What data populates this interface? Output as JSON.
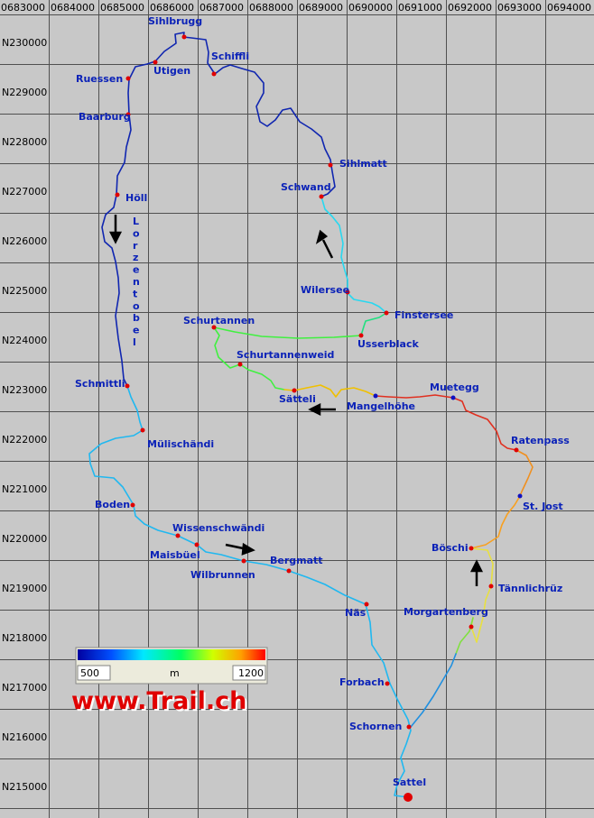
{
  "colors": {
    "background": "#c8c8c8",
    "grid": "#505050",
    "label": "#0b22b8",
    "waypoint": "#e00000",
    "pass_point": "#1010c0",
    "arrow": "#000000",
    "brand": "#e00000"
  },
  "grid": {
    "easting_labels": [
      "0683000",
      "0684000",
      "0685000",
      "0686000",
      "0687000",
      "0688000",
      "0689000",
      "0690000",
      "0691000",
      "0692000",
      "0693000",
      "0694000"
    ],
    "northing_labels": [
      "N230000",
      "N229000",
      "N228000",
      "N227000",
      "N226000",
      "N225000",
      "N224000",
      "N223000",
      "N222000",
      "N221000",
      "N220000",
      "N219000",
      "N218000",
      "N217000",
      "N216000",
      "N215000"
    ]
  },
  "places": [
    {
      "name": "Sihlbrugg"
    },
    {
      "name": "Schiffli"
    },
    {
      "name": "Utigen"
    },
    {
      "name": "Ruessen"
    },
    {
      "name": "Baarburg"
    },
    {
      "name": "Sihlmatt"
    },
    {
      "name": "Schwand"
    },
    {
      "name": "Höll"
    },
    {
      "name": "Wilersee"
    },
    {
      "name": "Finstersee"
    },
    {
      "name": "Schurtannen"
    },
    {
      "name": "Usserblack"
    },
    {
      "name": "Schurtannenweid"
    },
    {
      "name": "Sätteli"
    },
    {
      "name": "Mangelhöhe"
    },
    {
      "name": "Muetegg"
    },
    {
      "name": "Schmittli"
    },
    {
      "name": "Mülischändi"
    },
    {
      "name": "Ratenpass"
    },
    {
      "name": "Boden"
    },
    {
      "name": "St. Jost"
    },
    {
      "name": "Wissenschwändi"
    },
    {
      "name": "Maisbüel"
    },
    {
      "name": "Bergmatt"
    },
    {
      "name": "Wilbrunnen"
    },
    {
      "name": "Böschi"
    },
    {
      "name": "Tännlichrüz"
    },
    {
      "name": "Näs"
    },
    {
      "name": "Morgartenberg"
    },
    {
      "name": "Forbach"
    },
    {
      "name": "Schornen"
    },
    {
      "name": "Sattel"
    }
  ],
  "valley_label": "Lorzentobel",
  "legend": {
    "min": "500",
    "max": "1200",
    "unit": "m",
    "gradient": [
      "#0000a0",
      "#0050ff",
      "#00e8ff",
      "#00ff60",
      "#d0ff00",
      "#ffa000",
      "#ff0000"
    ]
  },
  "brand": "www.Trail.ch"
}
